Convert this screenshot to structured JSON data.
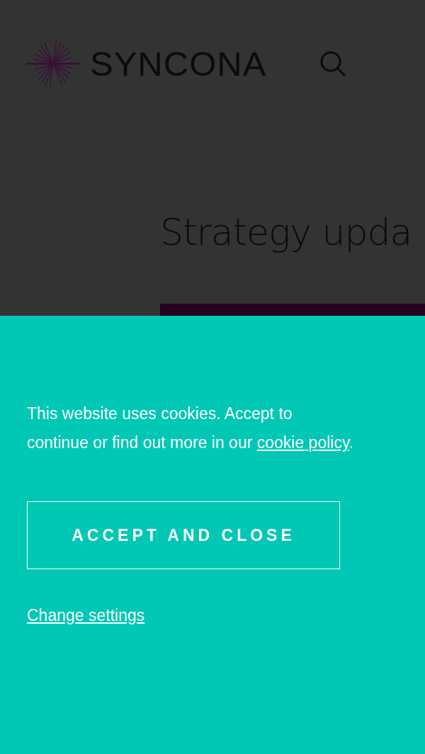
{
  "header": {
    "logo_text": "SYNCONA"
  },
  "hero": {
    "title": "Strategy upda"
  },
  "cookie_banner": {
    "message": "This website uses cookies. Accept to continue or find out more in our ",
    "link": "cookie policy",
    "message_end": ".",
    "accept_button": "ACCEPT AND CLOSE",
    "settings_link": "Change settings"
  }
}
